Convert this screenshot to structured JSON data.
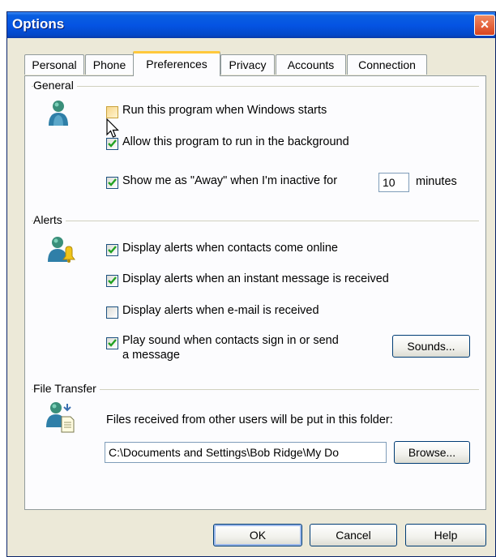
{
  "window": {
    "title": "Options",
    "close_symbol": "×"
  },
  "tabs": [
    {
      "label": "Personal",
      "active": false
    },
    {
      "label": "Phone",
      "active": false
    },
    {
      "label": "Preferences",
      "active": true
    },
    {
      "label": "Privacy",
      "active": false
    },
    {
      "label": "Accounts",
      "active": false
    },
    {
      "label": "Connection",
      "active": false
    }
  ],
  "general": {
    "label": "General",
    "icon": "user-icon",
    "run_on_startup": {
      "label": "Run this program when Windows starts",
      "checked": false
    },
    "allow_background": {
      "label": "Allow this program to run in the background",
      "checked": true
    },
    "away": {
      "label_before": "Show me as \"Away\" when I'm inactive for",
      "value": "10",
      "label_after": "minutes",
      "checked": true
    }
  },
  "alerts": {
    "label": "Alerts",
    "icon": "user-alert-icon",
    "contacts_online": {
      "label": "Display alerts when contacts come online",
      "checked": true
    },
    "instant_message": {
      "label": "Display alerts when an instant message is received",
      "checked": true
    },
    "email": {
      "label": "Display alerts when e-mail is received",
      "checked": false
    },
    "sound": {
      "label_line1": "Play sound when contacts sign in or send",
      "label_line2": "a message",
      "checked": true
    },
    "sounds_button": "Sounds..."
  },
  "file_transfer": {
    "label": "File Transfer",
    "icon": "file-transfer-icon",
    "description": "Files received from other users will be put in this folder:",
    "path": "C:\\Documents and Settings\\Bob Ridge\\My Do",
    "browse_button": "Browse..."
  },
  "footer": {
    "ok": "OK",
    "cancel": "Cancel",
    "help": "Help"
  }
}
